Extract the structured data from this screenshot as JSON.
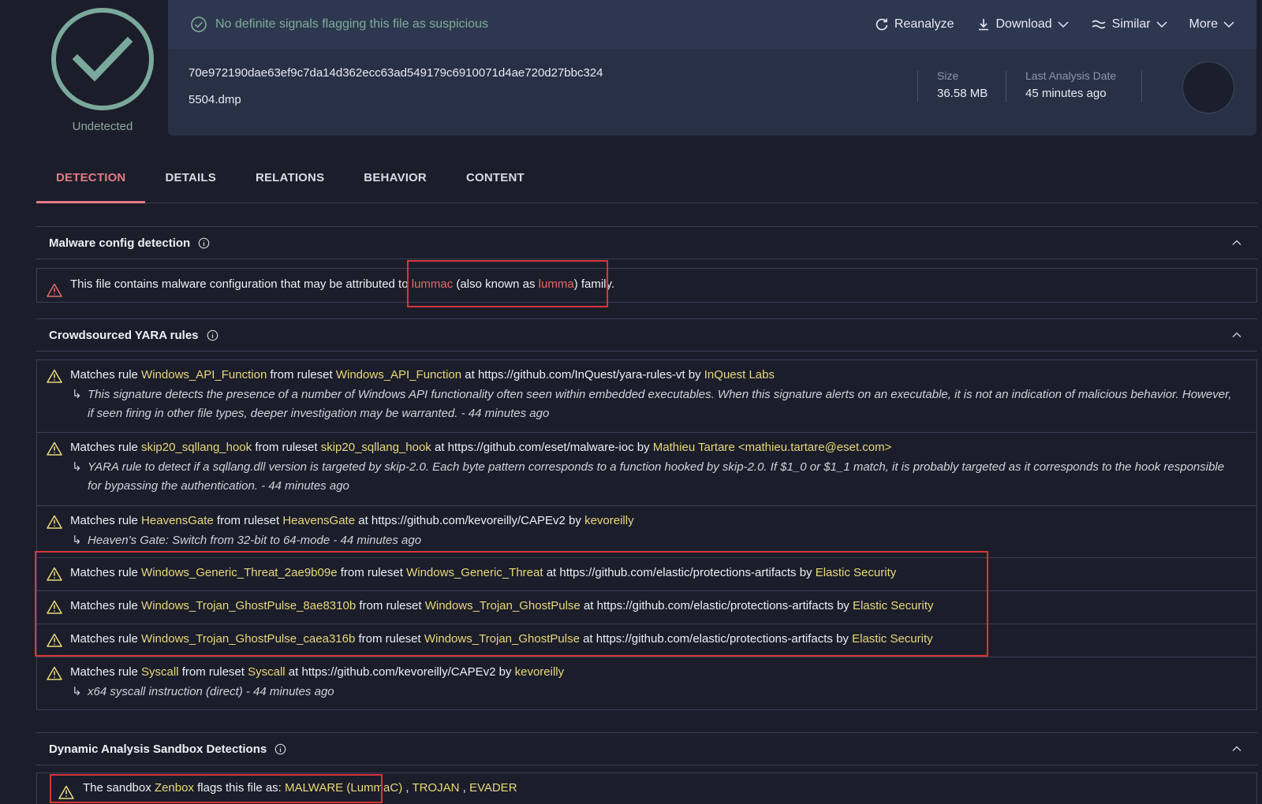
{
  "verdict": {
    "label": "Undetected",
    "color": "#7aa99b"
  },
  "header": {
    "status": "No definite signals flagging this file as suspicious",
    "actions": {
      "reanalyze": "Reanalyze",
      "download": "Download",
      "similar": "Similar",
      "more": "More"
    },
    "hash": "70e972190dae63ef9c7da14d362ecc63ad549179c6910071d4ae720d27bbc324",
    "filename": "5504.dmp",
    "size_label": "Size",
    "size_value": "36.58 MB",
    "last_analysis_label": "Last Analysis Date",
    "last_analysis_value": "45 minutes ago"
  },
  "tabs": [
    "DETECTION",
    "DETAILS",
    "RELATIONS",
    "BEHAVIOR",
    "CONTENT"
  ],
  "malware_config": {
    "title": "Malware config detection",
    "text_before": "This file contains malware configuration that may be attributed to",
    "family": "lummac",
    "aka_prefix": "(also known as",
    "alias": "lumma",
    "text_after": ") family."
  },
  "yara": {
    "title": "Crowdsourced YARA rules",
    "w_matches": "Matches rule",
    "w_from": "from ruleset",
    "w_at": "at",
    "w_by": "by",
    "rules": [
      {
        "rule": "Windows_API_Function",
        "ruleset": "Windows_API_Function",
        "url": "https://github.com/InQuest/yara-rules-vt",
        "author": "InQuest Labs",
        "desc": "This signature detects the presence of a number of Windows API functionality often seen within embedded executables. When this signature alerts on an executable, it is not an indication of malicious behavior. However, if seen firing in other file types, deeper investigation may be warranted. - 44 minutes ago"
      },
      {
        "rule": "skip20_sqllang_hook",
        "ruleset": "skip20_sqllang_hook",
        "url": "https://github.com/eset/malware-ioc",
        "author": "Mathieu Tartare <mathieu.tartare@eset.com>",
        "desc": "YARA rule to detect if a sqllang.dll version is targeted by skip-2.0. Each byte pattern corresponds to a function hooked by skip-2.0. If $1_0 or $1_1 match, it is probably targeted as it corresponds to the hook responsible for bypassing the authentication. - 44 minutes ago"
      },
      {
        "rule": "HeavensGate",
        "ruleset": "HeavensGate",
        "url": "https://github.com/kevoreilly/CAPEv2",
        "author": "kevoreilly",
        "desc": "Heaven's Gate: Switch from 32-bit to 64-mode - 44 minutes ago"
      },
      {
        "rule": "Windows_Generic_Threat_2ae9b09e",
        "ruleset": "Windows_Generic_Threat",
        "url": "https://github.com/elastic/protections-artifacts",
        "author": "Elastic Security",
        "desc": ""
      },
      {
        "rule": "Windows_Trojan_GhostPulse_8ae8310b",
        "ruleset": "Windows_Trojan_GhostPulse",
        "url": "https://github.com/elastic/protections-artifacts",
        "author": "Elastic Security",
        "desc": ""
      },
      {
        "rule": "Windows_Trojan_GhostPulse_caea316b",
        "ruleset": "Windows_Trojan_GhostPulse",
        "url": "https://github.com/elastic/protections-artifacts",
        "author": "Elastic Security",
        "desc": ""
      },
      {
        "rule": "Syscall",
        "ruleset": "Syscall",
        "url": "https://github.com/kevoreilly/CAPEv2",
        "author": "kevoreilly",
        "desc": "x64 syscall instruction (direct) - 44 minutes ago"
      }
    ]
  },
  "sandbox": {
    "title": "Dynamic Analysis Sandbox Detections",
    "prefix": "The sandbox",
    "name": "Zenbox",
    "middle": "flags this file as:",
    "tag1": "MALWARE (LummaC)",
    "tag2": "TROJAN",
    "tag3": "EVADER"
  },
  "colors": {
    "accent": "#e57a86",
    "link": "#e8d97a",
    "family": "#e56b6b",
    "highlight": "#d8343a",
    "ok": "#7fae99"
  }
}
